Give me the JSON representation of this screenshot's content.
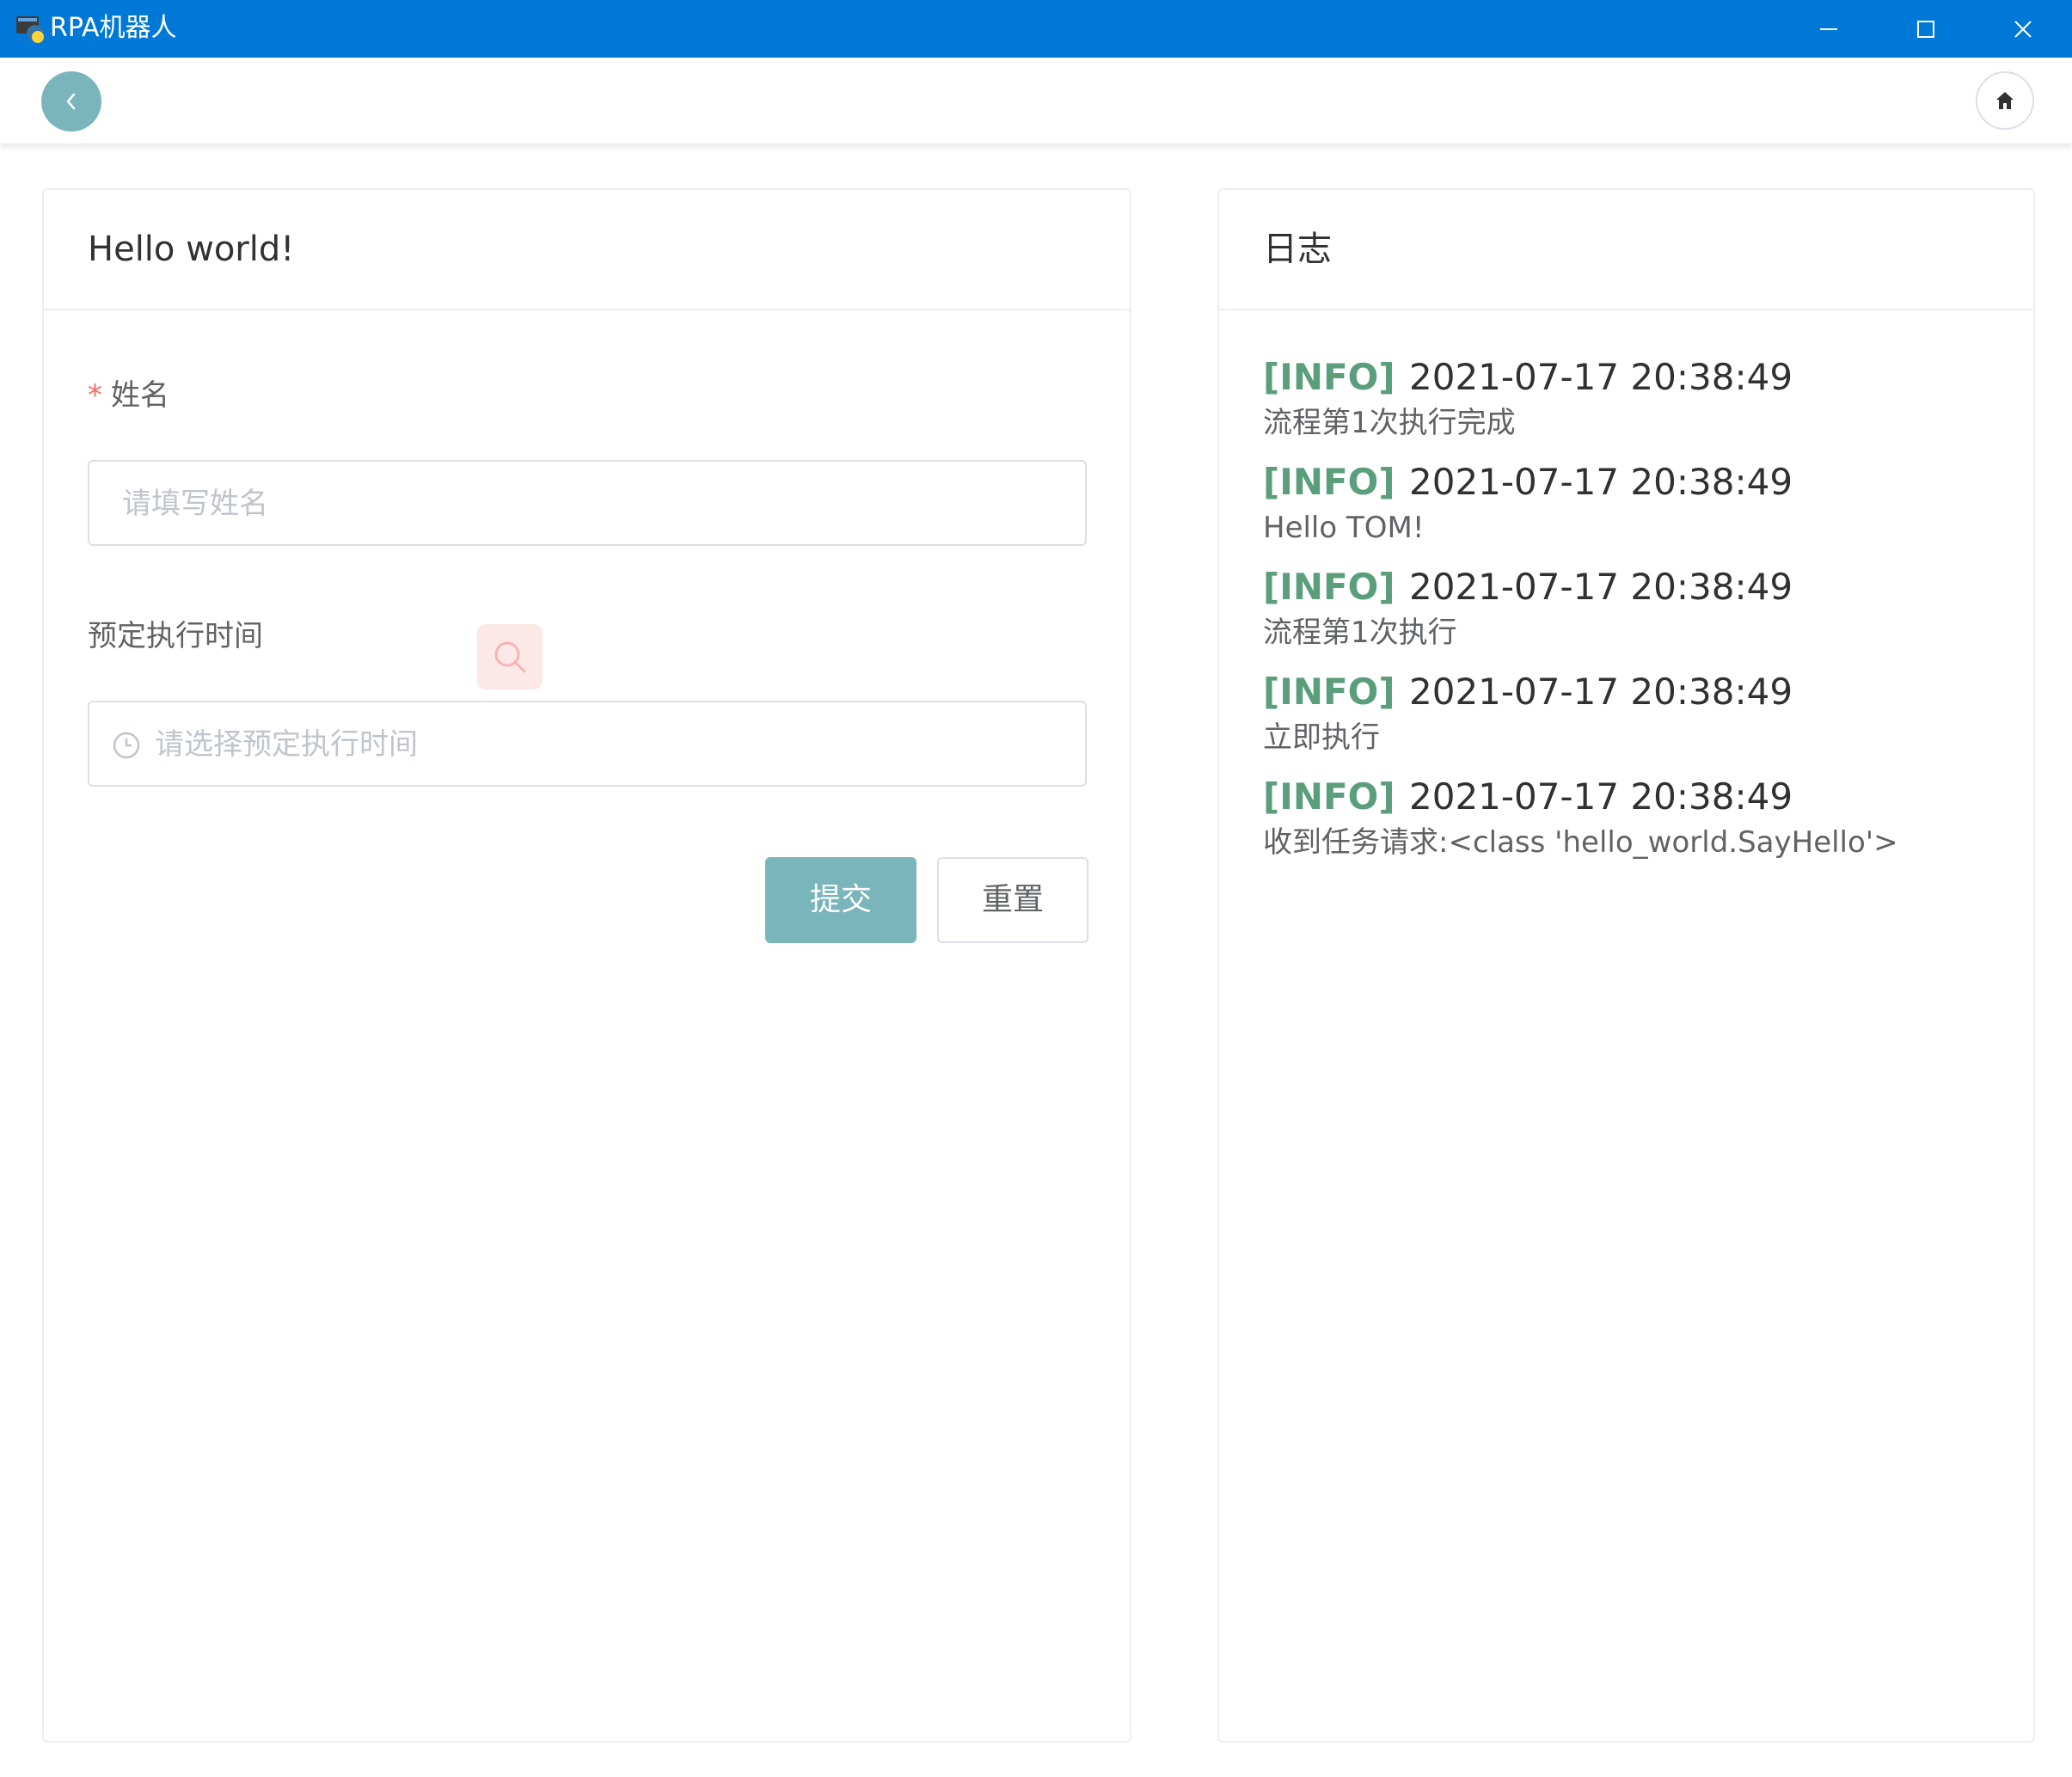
{
  "window": {
    "title": "RPA机器人",
    "titlebar_color": "#0078d7",
    "icons": [
      "app-icon",
      "minimize-icon",
      "maximize-icon",
      "close-icon"
    ]
  },
  "header": {
    "back_icon": "chevron-left-icon",
    "home_icon": "home-icon",
    "accent_color": "#7ab5bb"
  },
  "form_card": {
    "title": "Hello world!",
    "name_field": {
      "required_mark": "*",
      "label": "姓名",
      "placeholder": "请填写姓名",
      "value": ""
    },
    "time_field": {
      "label": "预定执行时间",
      "placeholder": "请选择预定执行时间",
      "icon": "clock-icon",
      "value": ""
    },
    "buttons": {
      "submit": "提交",
      "reset": "重置"
    }
  },
  "log_card": {
    "title": "日志",
    "level_color": "#5a9e7c",
    "entries": [
      {
        "level": "[INFO]",
        "time": "2021-07-17 20:38:49",
        "message": "流程第1次执行完成"
      },
      {
        "level": "[INFO]",
        "time": "2021-07-17 20:38:49",
        "message": "Hello TOM!"
      },
      {
        "level": "[INFO]",
        "time": "2021-07-17 20:38:49",
        "message": "流程第1次执行"
      },
      {
        "level": "[INFO]",
        "time": "2021-07-17 20:38:49",
        "message": "立即执行"
      },
      {
        "level": "[INFO]",
        "time": "2021-07-17 20:38:49",
        "message": "收到任务请求:<class 'hello_world.SayHello'>"
      }
    ]
  }
}
